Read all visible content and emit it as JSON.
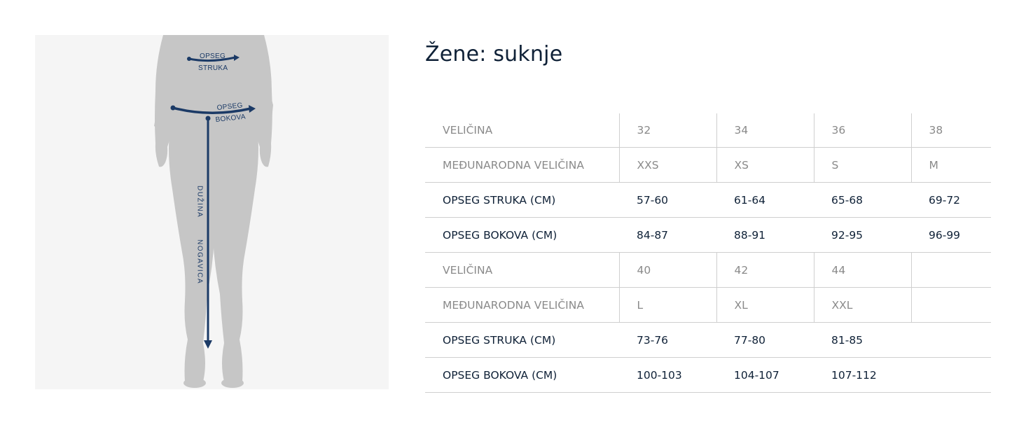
{
  "figure": {
    "waist_label_line1": "OPSEG",
    "waist_label_line2": "STRUKA",
    "hip_label_line1": "OPSEG",
    "hip_label_line2": "BOKOVA",
    "length_label_word1": "DUŽINA",
    "length_label_word2": "NOGAVICA",
    "accent_color": "#1b3a66",
    "silhouette_color": "#c6c6c6"
  },
  "title": "Žene: suknje",
  "table": {
    "rows": [
      {
        "type": "label",
        "header": "VELIČINA",
        "values": [
          "32",
          "34",
          "36",
          "38"
        ]
      },
      {
        "type": "label",
        "header": "MEĐUNARODNA VELIČINA",
        "values": [
          "XXS",
          "XS",
          "S",
          "M"
        ]
      },
      {
        "type": "measure",
        "header": "OPSEG STRUKA (CM)",
        "values": [
          "57-60",
          "61-64",
          "65-68",
          "69-72"
        ]
      },
      {
        "type": "measure",
        "header": "OPSEG BOKOVA (CM)",
        "values": [
          "84-87",
          "88-91",
          "92-95",
          "96-99"
        ]
      },
      {
        "type": "label",
        "header": "VELIČINA",
        "values": [
          "40",
          "42",
          "44",
          ""
        ]
      },
      {
        "type": "label",
        "header": "MEĐUNARODNA VELIČINA",
        "values": [
          "L",
          "XL",
          "XXL",
          ""
        ]
      },
      {
        "type": "measure",
        "header": "OPSEG STRUKA (CM)",
        "values": [
          "73-76",
          "77-80",
          "81-85",
          ""
        ]
      },
      {
        "type": "measure",
        "header": "OPSEG BOKOVA (CM)",
        "values": [
          "100-103",
          "104-107",
          "107-112",
          ""
        ]
      }
    ]
  }
}
